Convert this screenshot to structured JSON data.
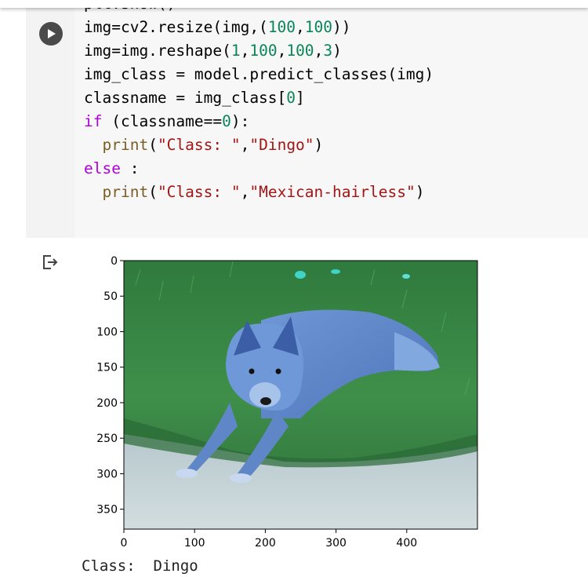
{
  "notebook": {
    "code_lines": [
      {
        "prefix": "img=cv2.resize(img,(",
        "n1": "100",
        "mid": ",",
        "n2": "100",
        "suffix": "))"
      },
      {
        "prefix": "img=img.reshape(",
        "n1": "1",
        "c1": ",",
        "n2": "100",
        "c2": ",",
        "n3": "100",
        "c3": ",",
        "n4": "3",
        "suffix": ")"
      },
      {
        "text": "img_class = model.predict_classes(img)"
      },
      {
        "prefix": "classname = img_class[",
        "n1": "0",
        "suffix": "]"
      },
      {
        "kw": "if",
        "prefix": " (classname==",
        "n1": "0",
        "suffix": "):"
      },
      {
        "indent": "  ",
        "fn": "print",
        "open": "(",
        "s1": "\"Class: \"",
        "comma": ",",
        "s2": "\"Dingo\"",
        "close": ")"
      },
      {
        "kw": "else",
        "suffix": " :"
      },
      {
        "indent": "  ",
        "fn": "print",
        "open": "(",
        "s1": "\"Class: \"",
        "comma": ",",
        "s2": "\"Mexican-hairless\"",
        "close": ")"
      }
    ],
    "output_text": "Class:  Dingo"
  },
  "plot": {
    "y_ticks": [
      "0",
      "50",
      "100",
      "150",
      "200",
      "250",
      "300",
      "350"
    ],
    "x_ticks": [
      "0",
      "100",
      "200",
      "300",
      "400"
    ],
    "image_description": "dingo",
    "colors": {
      "grass": "#3f8a4a",
      "dog": "#5d86c9",
      "sand": "#c4d2d6"
    }
  },
  "icons": {
    "run": "play-icon",
    "output": "output-icon"
  }
}
